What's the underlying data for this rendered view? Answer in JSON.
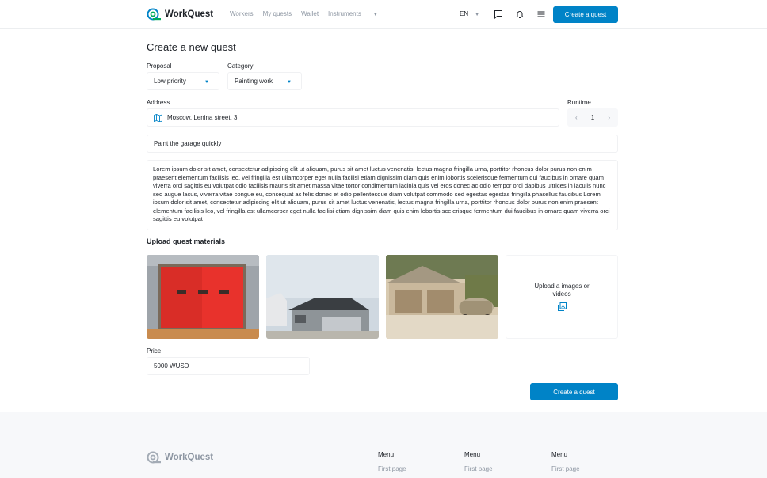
{
  "header": {
    "brand": "WorkQuest",
    "nav": [
      {
        "label": "Workers"
      },
      {
        "label": "My quests"
      },
      {
        "label": "Wallet"
      },
      {
        "label": "Instruments"
      }
    ],
    "language": "EN",
    "create_button": "Create a quest",
    "icons": [
      "chat-icon",
      "bell-icon",
      "menu-icon"
    ]
  },
  "form": {
    "title": "Create a new quest",
    "proposal_label": "Proposal",
    "proposal_value": "Low priority",
    "category_label": "Category",
    "category_value": "Painting work",
    "address_label": "Address",
    "address_value": "Moscow, Lenina street, 3",
    "runtime_label": "Runtime",
    "runtime_value": "1",
    "quest_title_value": "Paint the garage quickly",
    "description": "Lorem ipsum dolor sit amet, consectetur adipiscing elit ut aliquam, purus sit amet luctus venenatis, lectus magna fringilla urna, porttitor rhoncus dolor purus non enim praesent elementum facilisis leo, vel fringilla est ullamcorper eget nulla facilisi etiam dignissim diam quis enim lobortis scelerisque fermentum dui faucibus in ornare quam viverra orci sagittis eu volutpat odio facilisis mauris sit amet massa vitae tortor condimentum lacinia quis vel eros donec ac odio tempor orci dapibus ultrices in iaculis nunc sed augue lacus, viverra vitae congue eu, consequat ac felis donec et odio pellentesque diam volutpat commodo sed egestas egestas fringilla phasellus faucibus Lorem ipsum dolor sit amet, consectetur adipiscing elit ut aliquam, purus sit amet luctus venenatis, lectus magna fringilla urna, porttitor rhoncus dolor purus non enim praesent elementum facilisis leo, vel fringilla est ullamcorper eget nulla facilisi etiam dignissim diam quis enim lobortis scelerisque fermentum dui faucibus in ornare quam viverra orci sagittis eu volutpat",
    "materials_title": "Upload quest materials",
    "upload_text": "Upload a images or videos",
    "price_label": "Price",
    "price_value": "5000 WUSD",
    "submit_button": "Create a quest"
  },
  "footer": {
    "brand": "WorkQuest",
    "columns": [
      {
        "heading": "Menu",
        "link": "First page"
      },
      {
        "heading": "Menu",
        "link": "First page"
      },
      {
        "heading": "Menu",
        "link": "First page"
      }
    ]
  },
  "colors": {
    "accent": "#0083c7",
    "muted": "#8d96a2",
    "footer_bg": "#f7f8fa"
  }
}
